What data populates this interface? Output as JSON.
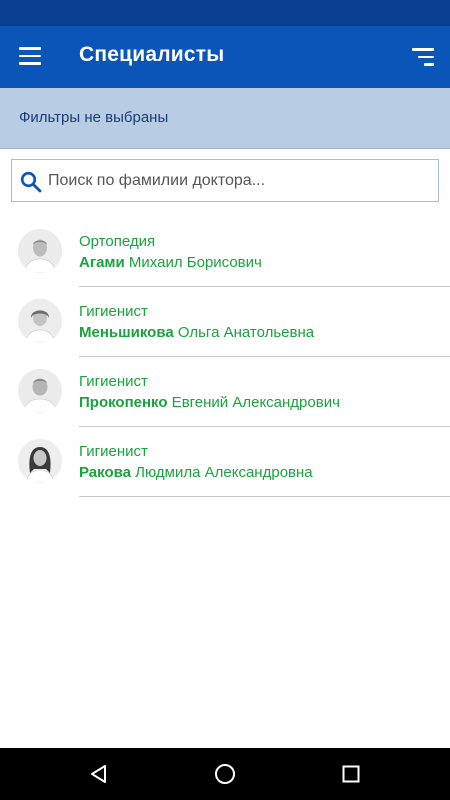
{
  "app_bar": {
    "title": "Специалисты",
    "menu_icon": "hamburger-menu-icon",
    "sort_icon": "sort-icon"
  },
  "filter": {
    "text": "Фильтры не выбраны"
  },
  "search": {
    "placeholder": "Поиск по фамилии доктора...",
    "value": ""
  },
  "doctors": [
    {
      "specialty": "Ортопедия",
      "last_name": "Агами",
      "first_names": " Михаил Борисович"
    },
    {
      "specialty": "Гигиенист",
      "last_name": "Меньшикова",
      "first_names": " Ольга Анатольевна"
    },
    {
      "specialty": "Гигиенист",
      "last_name": "Прокопенко",
      "first_names": " Евгений Александрович"
    },
    {
      "specialty": "Гигиенист",
      "last_name": "Ракова",
      "first_names": " Людмила Александровна"
    }
  ],
  "nav": {
    "back_icon": "back-triangle-icon",
    "home_icon": "home-circle-icon",
    "recents_icon": "recents-square-icon"
  },
  "colors": {
    "app_bar": "#0a55b8",
    "status_bar": "#0a3f8f",
    "filter_banner": "#b8cde3",
    "accent_green": "#19a33c"
  }
}
